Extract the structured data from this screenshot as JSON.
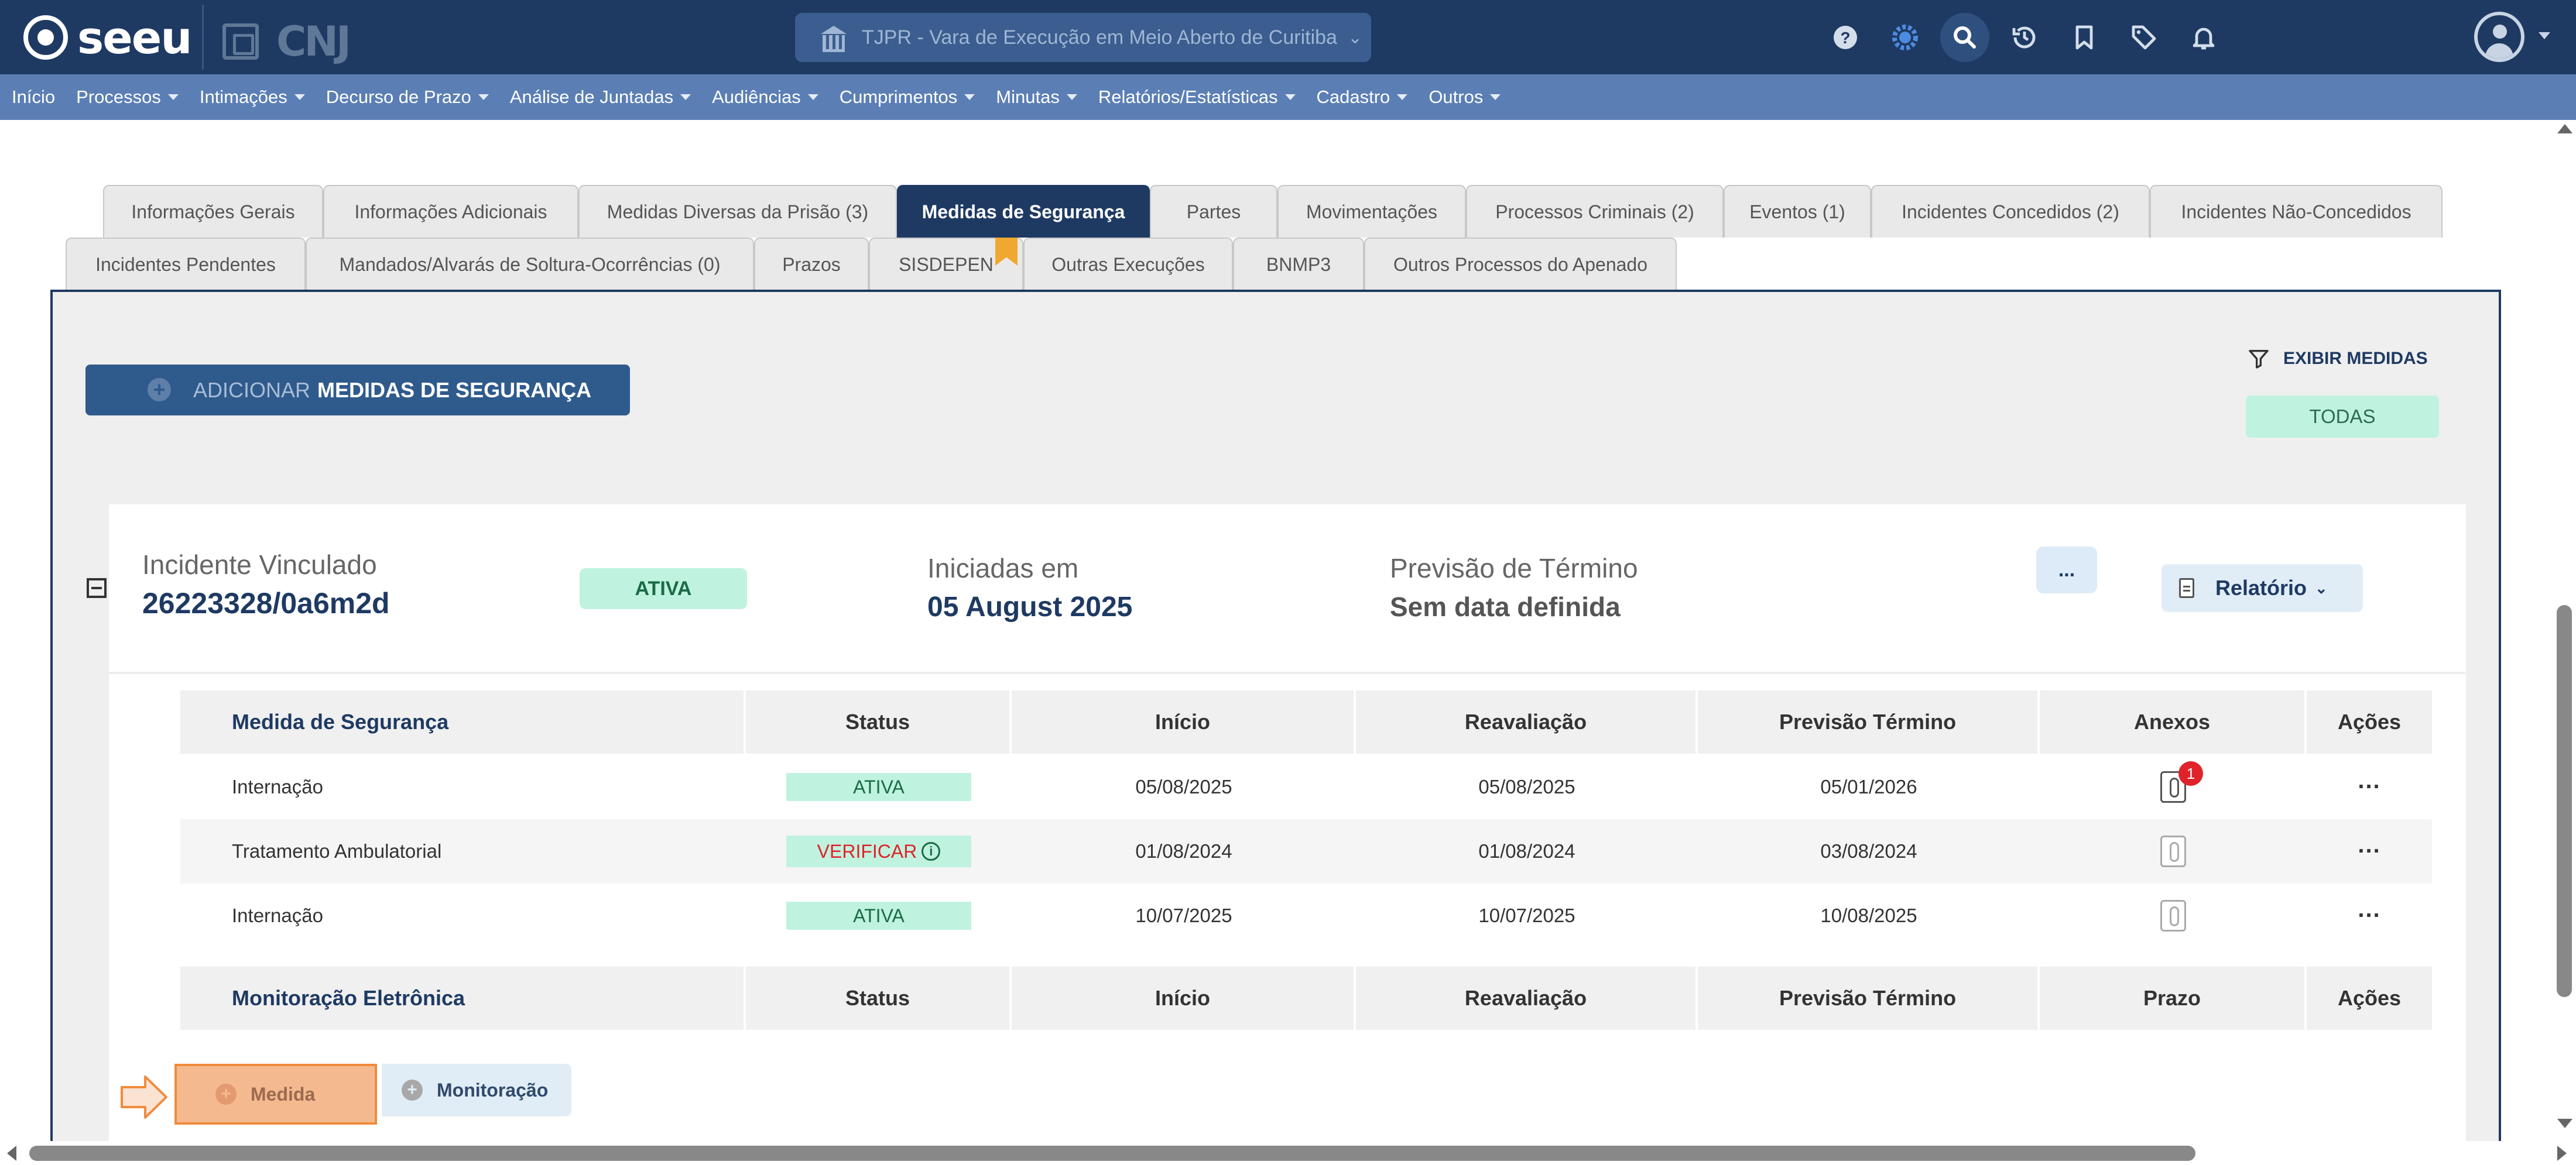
{
  "app": {
    "logo_text": "seeu",
    "cnj_text": "CNJ",
    "court": "TJPR - Vara de Execução em Meio Aberto de Curitiba",
    "top_icons": [
      "help-icon",
      "theme-toggle-icon",
      "search-icon",
      "history-icon",
      "bookmark-icon",
      "tag-icon",
      "bell-icon"
    ]
  },
  "menu": [
    {
      "label": "Início",
      "dropdown": false
    },
    {
      "label": "Processos",
      "dropdown": true
    },
    {
      "label": "Intimações",
      "dropdown": true
    },
    {
      "label": "Decurso de Prazo",
      "dropdown": true
    },
    {
      "label": "Análise de Juntadas",
      "dropdown": true
    },
    {
      "label": "Audiências",
      "dropdown": true
    },
    {
      "label": "Cumprimentos",
      "dropdown": true
    },
    {
      "label": "Minutas",
      "dropdown": true
    },
    {
      "label": "Relatórios/Estatísticas",
      "dropdown": true
    },
    {
      "label": "Cadastro",
      "dropdown": true
    },
    {
      "label": "Outros",
      "dropdown": true
    }
  ],
  "tabs_row1": [
    "Informações Gerais",
    "Informações Adicionais",
    "Medidas Diversas da Prisão (3)",
    "Medidas de Segurança",
    "Partes",
    "Movimentações",
    "Processos Criminais (2)",
    "Eventos (1)",
    "Incidentes Concedidos (2)",
    "Incidentes Não-Concedidos"
  ],
  "tabs_row2": [
    "Incidentes Pendentes",
    "Mandados/Alvarás de Soltura-Ocorrências (0)",
    "Prazos",
    "SISDEPEN",
    "Outras Execuções",
    "BNMP3",
    "Outros Processos do Apenado"
  ],
  "active_tab": "Medidas de Segurança",
  "toolbar": {
    "add_prefix": "ADICIONAR",
    "add_label": "MEDIDAS DE SEGURANÇA",
    "filter_label": "EXIBIR MEDIDAS",
    "filter_value": "TODAS"
  },
  "incident": {
    "label": "Incidente Vinculado",
    "number_prefix": "26223328/",
    "number_suffix": "0a6m2d",
    "status": "ATIVA",
    "start_label": "Iniciadas em",
    "start_value": "05 August 2025",
    "end_label": "Previsão de Término",
    "end_value": "Sem data definida",
    "more_label": "...",
    "report_label": "Relatório"
  },
  "measures_table": {
    "headers": [
      "Medida de Segurança",
      "Status",
      "Início",
      "Reavaliação",
      "Previsão Término",
      "Anexos",
      "Ações"
    ],
    "rows": [
      {
        "medida": "Internação",
        "status": "ATIVA",
        "inicio": "05/08/2025",
        "reavaliacao": "05/08/2025",
        "previsao": "05/01/2026",
        "anexos_count": "1"
      },
      {
        "medida": "Tratamento Ambulatorial",
        "status": "VERIFICAR",
        "inicio": "01/08/2024",
        "reavaliacao": "01/08/2024",
        "previsao": "03/08/2024",
        "anexos_count": ""
      },
      {
        "medida": "Internação",
        "status": "ATIVA",
        "inicio": "10/07/2025",
        "reavaliacao": "10/07/2025",
        "previsao": "10/08/2025",
        "anexos_count": ""
      }
    ],
    "actions_label": "..."
  },
  "monitoring_table": {
    "headers": [
      "Monitoração Eletrônica",
      "Status",
      "Início",
      "Reavaliação",
      "Previsão Término",
      "Prazo",
      "Ações"
    ]
  },
  "bottom_buttons": {
    "medida": "Medida",
    "monitoracao": "Monitoração"
  },
  "colors": {
    "header_bg": "#1e3a63",
    "menu_bg": "#5b7fb5",
    "status_green_bg": "#bff3df",
    "status_red_text": "#e0222a",
    "highlight_orange": "#f08b3c"
  }
}
